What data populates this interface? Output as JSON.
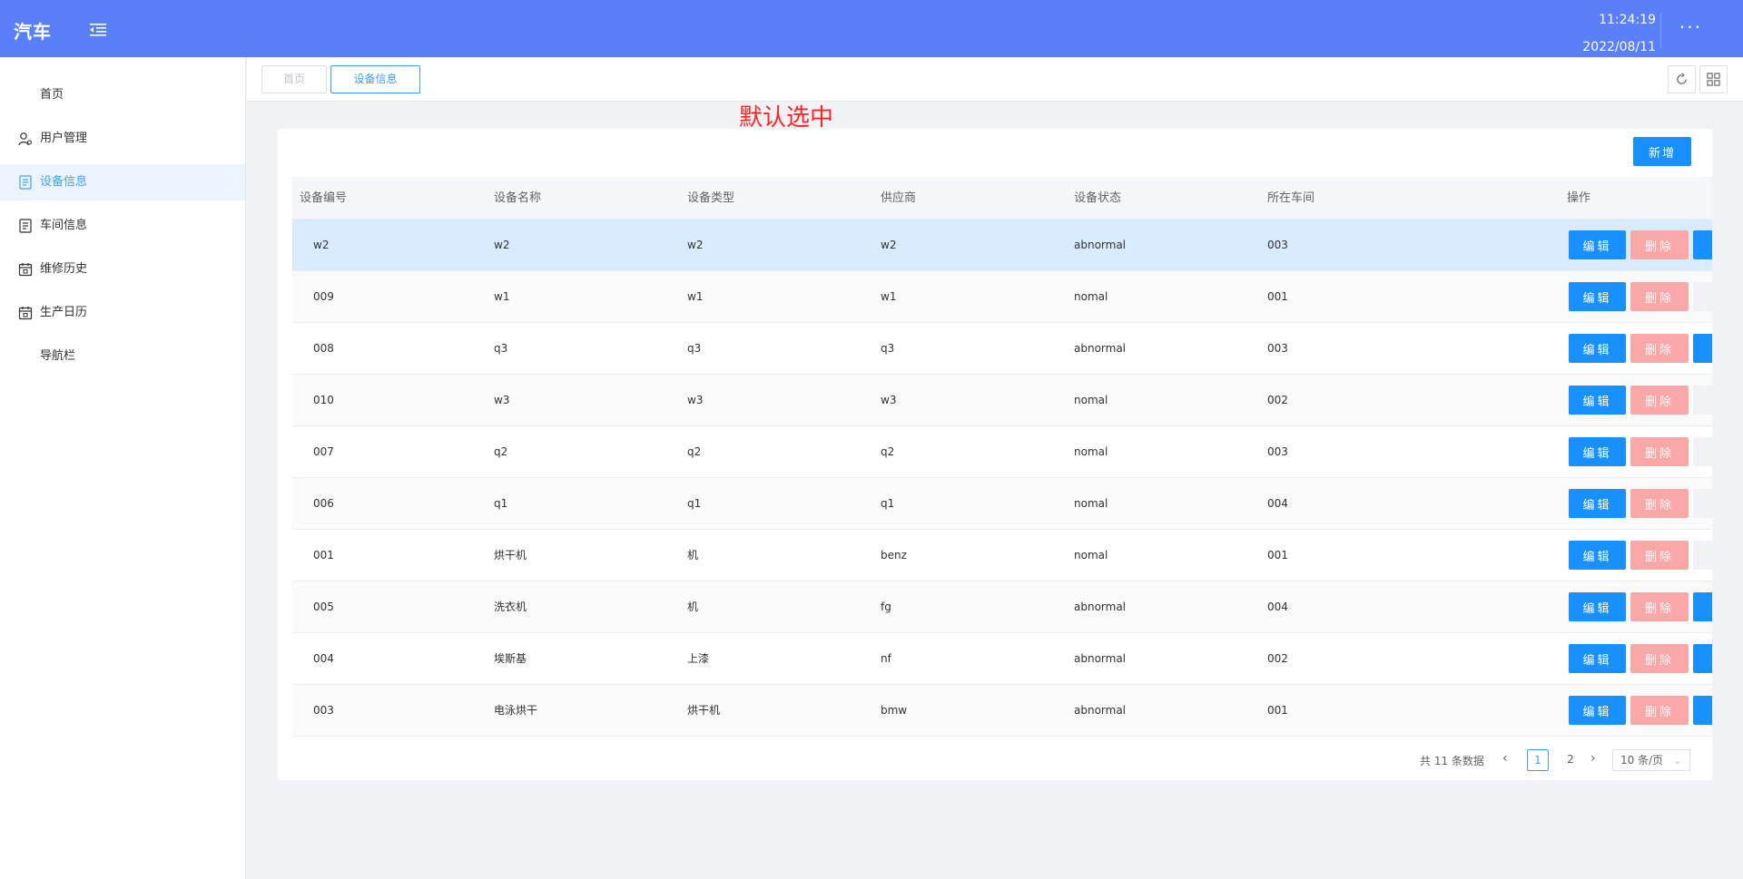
{
  "header": {
    "logo": "汽车",
    "time": "11:24:19",
    "date": "2022/08/11",
    "more": "···"
  },
  "sidebar": {
    "items": [
      {
        "label": "首页",
        "icon": ""
      },
      {
        "label": "用户管理",
        "icon": "user-icon"
      },
      {
        "label": "设备信息",
        "icon": "document-icon"
      },
      {
        "label": "车间信息",
        "icon": "document-icon"
      },
      {
        "label": "维修历史",
        "icon": "calendar-icon"
      },
      {
        "label": "生产日历",
        "icon": "calendar-icon"
      },
      {
        "label": "导航栏",
        "icon": ""
      }
    ],
    "active_index": 2
  },
  "tabs": [
    {
      "label": "首页"
    },
    {
      "label": "设备信息"
    }
  ],
  "annotation": "默认选中",
  "toolbar": {
    "add_label": "新增"
  },
  "table": {
    "columns": [
      "设备编号",
      "设备名称",
      "设备类型",
      "供应商",
      "设备状态",
      "所在车间",
      "操作"
    ],
    "rows": [
      [
        "w2",
        "w2",
        "w2",
        "w2",
        "abnormal",
        "003"
      ],
      [
        "009",
        "w1",
        "w1",
        "w1",
        "nomal",
        "001"
      ],
      [
        "008",
        "q3",
        "q3",
        "q3",
        "abnormal",
        "003"
      ],
      [
        "010",
        "w3",
        "w3",
        "w3",
        "nomal",
        "002"
      ],
      [
        "007",
        "q2",
        "q2",
        "q2",
        "nomal",
        "003"
      ],
      [
        "006",
        "q1",
        "q1",
        "q1",
        "nomal",
        "004"
      ],
      [
        "001",
        "烘干机",
        "机",
        "benz",
        "nomal",
        "001"
      ],
      [
        "005",
        "洗衣机",
        "机",
        "fg",
        "abnormal",
        "004"
      ],
      [
        "004",
        "埃斯基",
        "上漆",
        "nf",
        "abnormal",
        "002"
      ],
      [
        "003",
        "电泳烘干",
        "烘干机",
        "bmw",
        "abnormal",
        "001"
      ]
    ],
    "edit_label": "编辑",
    "delete_label": "删除"
  },
  "pagination": {
    "total_text": "共 11 条数据",
    "pages": [
      "1",
      "2"
    ],
    "current": "1",
    "page_size": "10 条/页"
  },
  "colors": {
    "header_bg": "#5a7ffa",
    "primary": "#1890ff",
    "danger_light": "#f9a7a7",
    "annotation": "#ff2222"
  }
}
